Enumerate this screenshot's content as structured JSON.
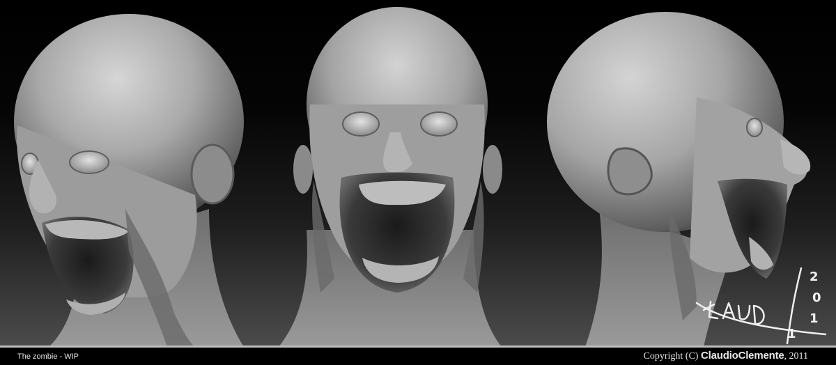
{
  "image": {
    "subject": "Three grayscale digital sculpture renders of a zombie head (left three-quarter, front, right profile)",
    "views": [
      "three-quarter-left",
      "front",
      "profile-right"
    ]
  },
  "footer": {
    "caption": "The zombie - WIP",
    "copyright_prefix": "Copyright (C)",
    "author": "ClaudioClemente",
    "year_suffix": ", 2011"
  },
  "signature": {
    "name_letters": "CLAUD",
    "year_digits": [
      "2",
      "0",
      "1",
      "1"
    ]
  },
  "colors": {
    "background_top": "#000000",
    "background_bottom": "#4a4a4a",
    "clay": "#a8a8a8",
    "flesh_dark": "#3a3a3a",
    "text": "#e6e6e6",
    "divider": "#bdbdbd"
  }
}
